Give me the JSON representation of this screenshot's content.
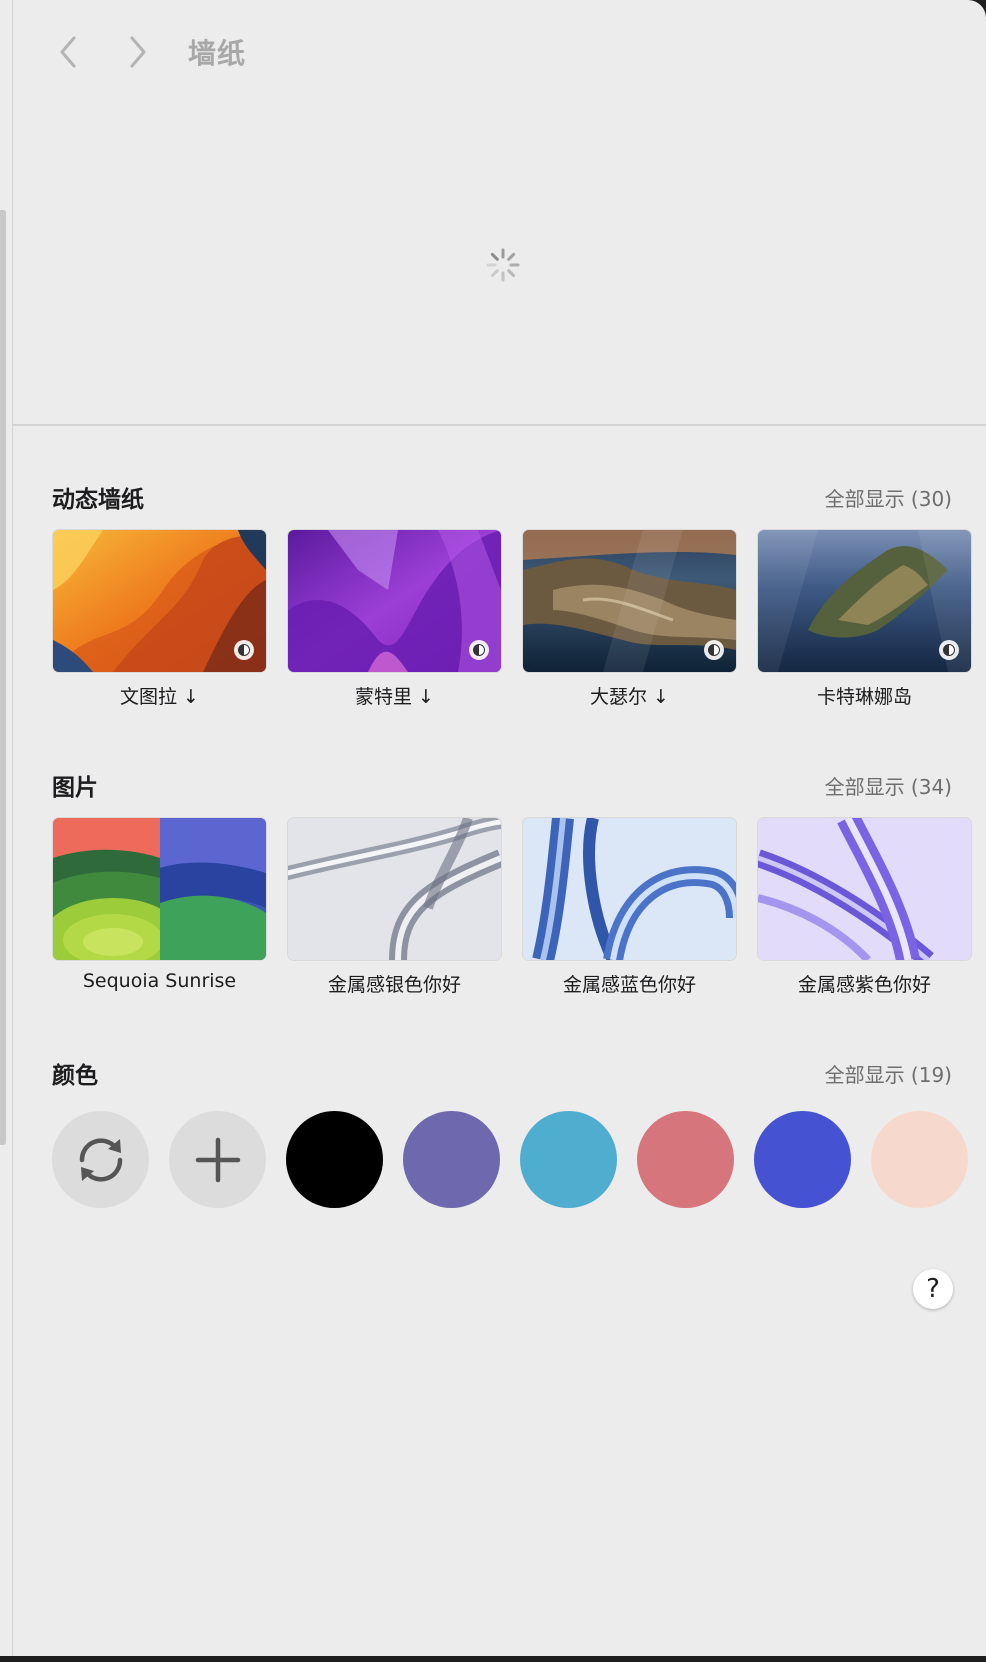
{
  "window": {
    "title": "墙纸"
  },
  "nav": {
    "back_icon": "chevron-left-icon",
    "forward_icon": "chevron-right-icon"
  },
  "sections": {
    "dynamic": {
      "title": "动态墙纸",
      "show_all": "全部显示 (30)",
      "items": [
        {
          "label": "文图拉",
          "download": "↓"
        },
        {
          "label": "蒙特里",
          "download": "↓"
        },
        {
          "label": "大瑟尔",
          "download": "↓"
        },
        {
          "label": "卡特琳娜岛",
          "download": ""
        }
      ]
    },
    "pictures": {
      "title": "图片",
      "show_all": "全部显示 (34)",
      "items": [
        {
          "label": "Sequoia Sunrise"
        },
        {
          "label": "金属感银色你好"
        },
        {
          "label": "金属感蓝色你好"
        },
        {
          "label": "金属感紫色你好"
        }
      ]
    },
    "colors": {
      "title": "颜色",
      "show_all": "全部显示 (19)",
      "swatches": [
        "#000000",
        "#6e68ae",
        "#4fadd0",
        "#d6757c",
        "#4553d2",
        "#f6d9cc"
      ],
      "refresh_icon": "refresh-icon",
      "add_icon": "plus-icon"
    }
  },
  "help": {
    "label": "?"
  }
}
